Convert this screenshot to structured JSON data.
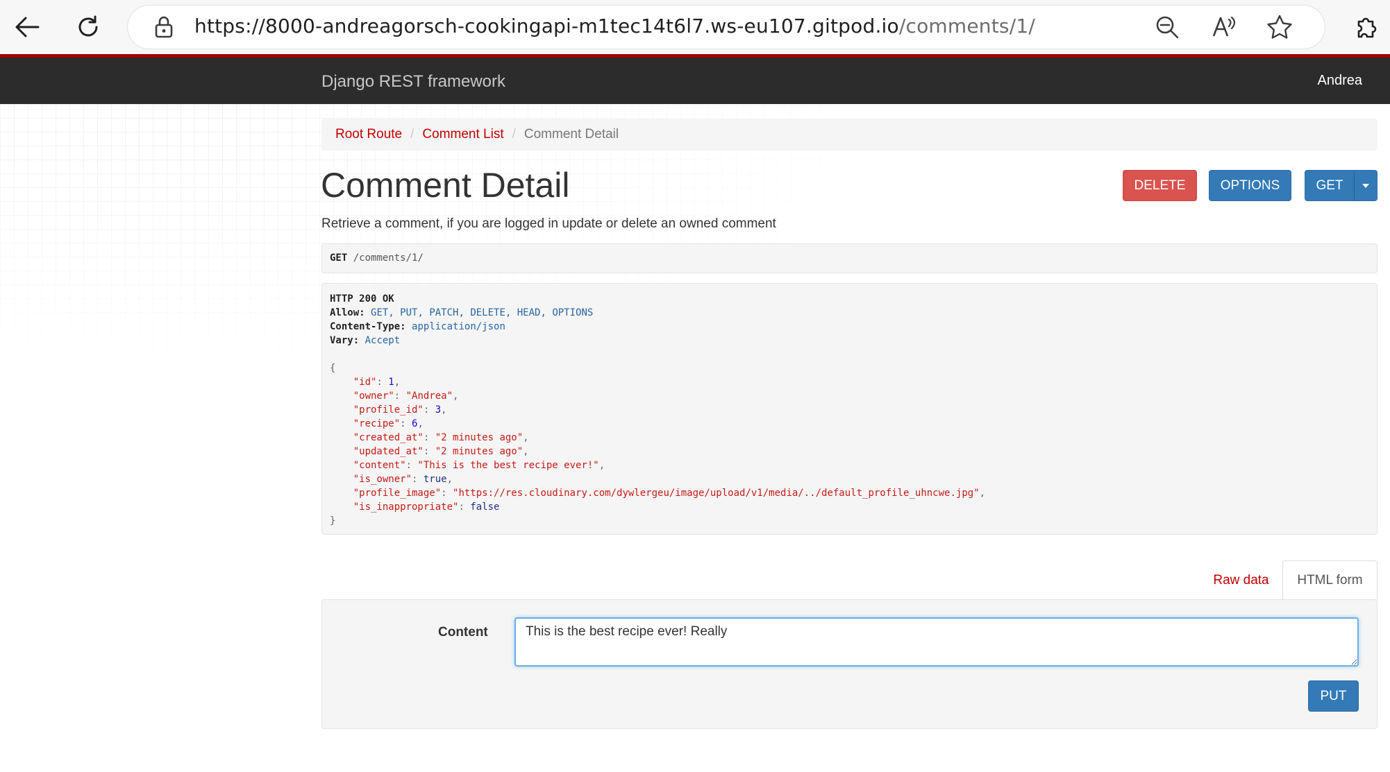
{
  "browser": {
    "url_host": "https://8000-andreagorsch-cookingapi-m1tec14t6l7.ws-eu107.gitpod.io",
    "url_path": "/comments/1/",
    "icons": [
      "back-arrow-icon",
      "refresh-icon",
      "lock-icon",
      "zoom-out-icon",
      "read-aloud-icon",
      "favorite-star-icon",
      "extensions-icon"
    ]
  },
  "navbar": {
    "brand": "Django REST framework",
    "user": "Andrea",
    "bg_color": "#2c2c2c",
    "accent_color": "#a30000"
  },
  "breadcrumb": [
    {
      "label": "Root Route",
      "active": false
    },
    {
      "label": "Comment List",
      "active": false
    },
    {
      "label": "Comment Detail",
      "active": true
    }
  ],
  "page": {
    "title": "Comment Detail",
    "description": "Retrieve a comment, if you are logged in update or delete an owned comment"
  },
  "actions": {
    "delete_label": "DELETE",
    "options_label": "OPTIONS",
    "get_label": "GET"
  },
  "request": {
    "method": "GET",
    "path": "/comments/1/"
  },
  "response": {
    "status_line": "HTTP 200 OK",
    "headers": [
      {
        "key": "Allow",
        "value": "GET, PUT, PATCH, DELETE, HEAD, OPTIONS"
      },
      {
        "key": "Content-Type",
        "value": "application/json"
      },
      {
        "key": "Vary",
        "value": "Accept"
      }
    ],
    "body": [
      {
        "key": "id",
        "value": "1",
        "type": "num"
      },
      {
        "key": "owner",
        "value": "\"Andrea\"",
        "type": "str"
      },
      {
        "key": "profile_id",
        "value": "3",
        "type": "num"
      },
      {
        "key": "recipe",
        "value": "6",
        "type": "num"
      },
      {
        "key": "created_at",
        "value": "\"2 minutes ago\"",
        "type": "str"
      },
      {
        "key": "updated_at",
        "value": "\"2 minutes ago\"",
        "type": "str"
      },
      {
        "key": "content",
        "value": "\"This is the best recipe ever!\"",
        "type": "str"
      },
      {
        "key": "is_owner",
        "value": "true",
        "type": "lit"
      },
      {
        "key": "profile_image",
        "value": "\"https://res.cloudinary.com/dywlergeu/image/upload/v1/media/../default_profile_uhncwe.jpg\"",
        "type": "str"
      },
      {
        "key": "is_inappropriate",
        "value": "false",
        "type": "lit"
      }
    ]
  },
  "tabs": {
    "raw_label": "Raw data",
    "html_label": "HTML form",
    "active": "HTML form"
  },
  "form": {
    "content_label": "Content",
    "content_value": "This is the best recipe ever! Really",
    "submit_label": "PUT"
  }
}
